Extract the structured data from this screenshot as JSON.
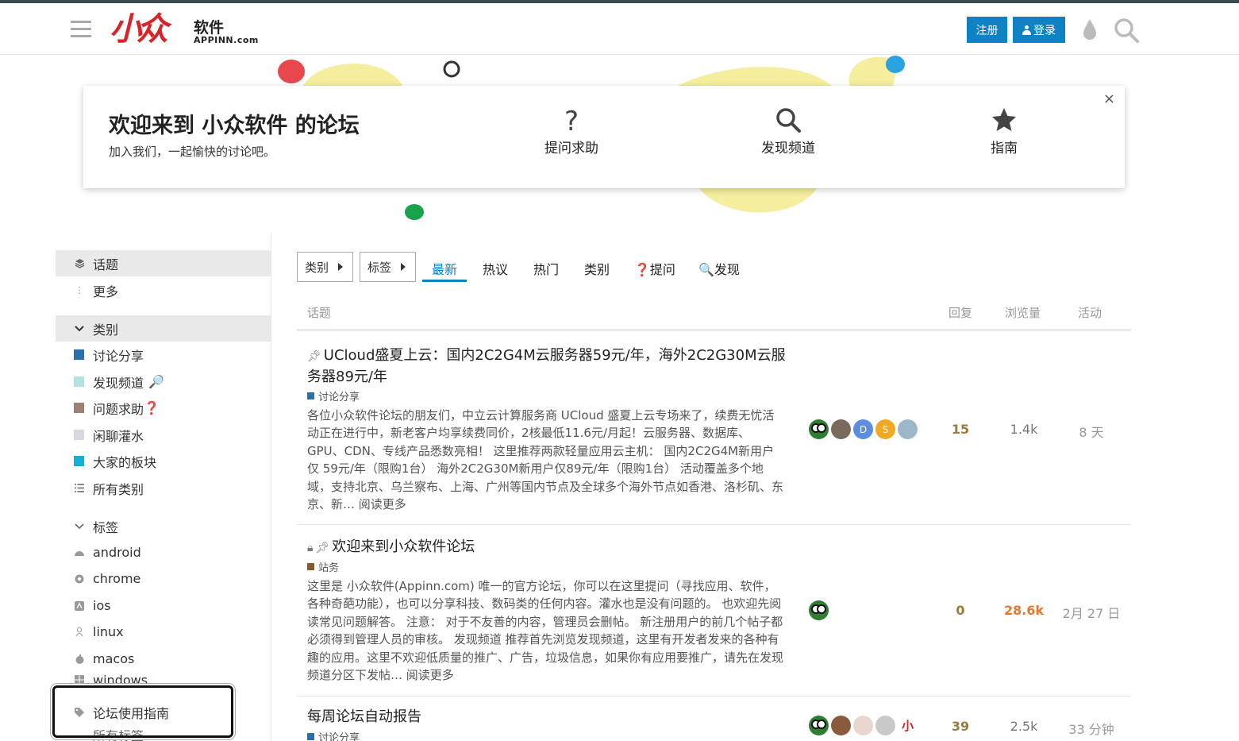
{
  "header": {
    "logo_cn": "软件",
    "logo_en": "APPINN.com",
    "logo_mark": "小众",
    "signup_label": "注册",
    "login_label": "登录"
  },
  "banner": {
    "title": "欢迎来到 小众软件 的论坛",
    "subtitle": "加入我们，一起愉快的讨论吧。",
    "close": "×",
    "links": [
      {
        "label": "提问求助",
        "icon": "question-icon"
      },
      {
        "label": "发现频道",
        "icon": "search-icon"
      },
      {
        "label": "指南",
        "icon": "star-icon"
      }
    ]
  },
  "sidebar": {
    "topics": "话题",
    "more": "更多",
    "categories_header": "类别",
    "categories": [
      {
        "label": "讨论分享",
        "color": "#2a6fb0"
      },
      {
        "label": "发现频道",
        "color": "#b5e2e0",
        "emoji": "🔎"
      },
      {
        "label": "问题求助",
        "color": "#a08070",
        "emoji": "❓"
      },
      {
        "label": "闲聊灌水",
        "color": "#d6dade"
      },
      {
        "label": "大家的板块",
        "color": "#12b0d8"
      }
    ],
    "all_categories": "所有类别",
    "tags_header": "标签",
    "tags": [
      "android",
      "chrome",
      "ios",
      "linux",
      "macos",
      "windows"
    ],
    "guide": "论坛使用指南",
    "all_tags": "所有标签"
  },
  "nav": {
    "category_filter": "类别",
    "tag_filter": "标签",
    "tabs": [
      "最新",
      "热议",
      "热门",
      "类别",
      "❓提问",
      "🔍发现"
    ]
  },
  "table": {
    "headers": {
      "topic": "话题",
      "replies": "回复",
      "views": "浏览量",
      "activity": "活动"
    },
    "rows": [
      {
        "title": "UCloud盛夏上云：国内2C2G4M云服务器59元/年，海外2C2G30M云服务器89元/年",
        "category": "讨论分享",
        "category_color": "#2a6fb0",
        "excerpt": "各位小众软件论坛的朋友们，中立云计算服务商 UCloud 盛夏上云专场来了，续费无忧活动正在进行中，新老客户均享续费同价，2核最低11.6元/月起！云服务器、数据库、GPU、CDN、专线产品悉数亮相！ 这里推荐两款轻量应用云主机： 国内2C2G4M新用户仅 59元/年（限购1台） 海外2C2G30M新用户仅89元/年（限购1台） 活动覆盖多个地域，支持北京、乌兰察布、上海、广州等国内节点及全球多个海外节点如香港、洛杉矶、东京、新…",
        "read_more": "阅读更多",
        "replies": "15",
        "views": "1.4k",
        "activity": "8 天",
        "avatars": [
          "frog",
          "photo",
          "D",
          "S",
          "photo2"
        ]
      },
      {
        "title": "欢迎来到小众软件论坛",
        "category": "站务",
        "category_color": "#8b5a2b",
        "excerpt": "这里是 小众软件(Appinn.com) 唯一的官方论坛，你可以在这里提问（寻找应用、软件，各种奇葩功能），也可以分享科技、数码类的任何内容。灌水也是没有问题的。 也欢迎先阅读常见问题解答。 注意： 对于不友善的内容，管理员会删帖。 新注册用户的前几个帖子都必须得到管理人员的审核。 发现频道 推荐首先浏览发现频道，这里有开发者发来的各种有趣的应用。这里不欢迎低质量的推广、广告，垃圾信息，如果你有应用要推广，请先在发现频道分区下发帖…",
        "read_more": "阅读更多",
        "replies": "0",
        "views": "28.6k",
        "activity": "2月 27 日",
        "avatars": [
          "frog"
        ]
      },
      {
        "title": "每周论坛自动报告",
        "category": "讨论分享",
        "category_color": "#2a6fb0",
        "replies": "39",
        "views": "2.5k",
        "activity": "33 分钟",
        "avatars": [
          "frog",
          "photo3",
          "photo4",
          "photo5",
          "logo"
        ]
      }
    ]
  },
  "colors": {
    "accent": "#0f82c3",
    "brand_red": "#d8232a",
    "hot_views": "#e8772e"
  }
}
